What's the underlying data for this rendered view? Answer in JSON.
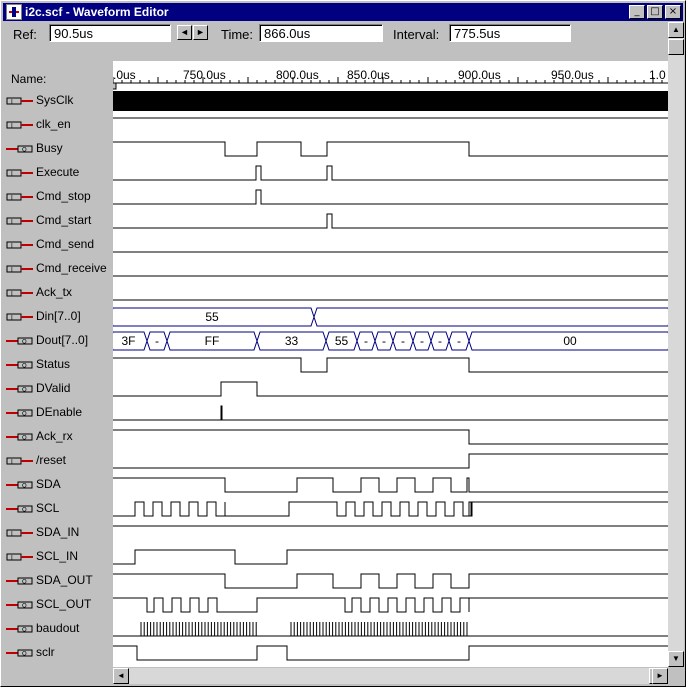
{
  "window": {
    "title": "i2c.scf - Waveform Editor",
    "buttons": {
      "minimize": "_",
      "maximize": "□",
      "close": "×"
    }
  },
  "toolbar": {
    "ref_label": "Ref:",
    "ref_value": "90.5us",
    "time_label": "Time:",
    "time_value": "866.0us",
    "interval_label": "Interval:",
    "interval_value": "775.5us",
    "prev_arrow": "◄",
    "next_arrow": "►"
  },
  "name_header": "Name:",
  "time_axis": [
    ".0us",
    "750.0us",
    "800.0us",
    "850.0us",
    "900.0us",
    "950.0us",
    "1.0"
  ],
  "signals": [
    {
      "name": "SysClk",
      "dir": "in"
    },
    {
      "name": "clk_en",
      "dir": "in"
    },
    {
      "name": "Busy",
      "dir": "out"
    },
    {
      "name": "Execute",
      "dir": "in"
    },
    {
      "name": "Cmd_stop",
      "dir": "in"
    },
    {
      "name": "Cmd_start",
      "dir": "in"
    },
    {
      "name": "Cmd_send",
      "dir": "in"
    },
    {
      "name": "Cmd_receive",
      "dir": "in"
    },
    {
      "name": "Ack_tx",
      "dir": "in"
    },
    {
      "name": "Din[7..0]",
      "dir": "in"
    },
    {
      "name": "Dout[7..0]",
      "dir": "out"
    },
    {
      "name": "Status",
      "dir": "out"
    },
    {
      "name": "DValid",
      "dir": "out"
    },
    {
      "name": "DEnable",
      "dir": "out"
    },
    {
      "name": "Ack_rx",
      "dir": "out"
    },
    {
      "name": "/reset",
      "dir": "in"
    },
    {
      "name": "SDA",
      "dir": "out"
    },
    {
      "name": "SCL",
      "dir": "out"
    },
    {
      "name": "SDA_IN",
      "dir": "in"
    },
    {
      "name": "SCL_IN",
      "dir": "in"
    },
    {
      "name": "SDA_OUT",
      "dir": "out"
    },
    {
      "name": "SCL_OUT",
      "dir": "out"
    },
    {
      "name": "baudout",
      "dir": "out"
    },
    {
      "name": "sclr",
      "dir": "out"
    }
  ],
  "bus_values": {
    "din": [
      "55"
    ],
    "dout": [
      "3F",
      "-",
      "FF",
      "33",
      "55",
      "-",
      "-",
      "-",
      "-",
      "-",
      "-",
      "00"
    ]
  },
  "colors": {
    "titlebar": "#000080",
    "input_pin": "#c00000",
    "bus": "#000080"
  }
}
